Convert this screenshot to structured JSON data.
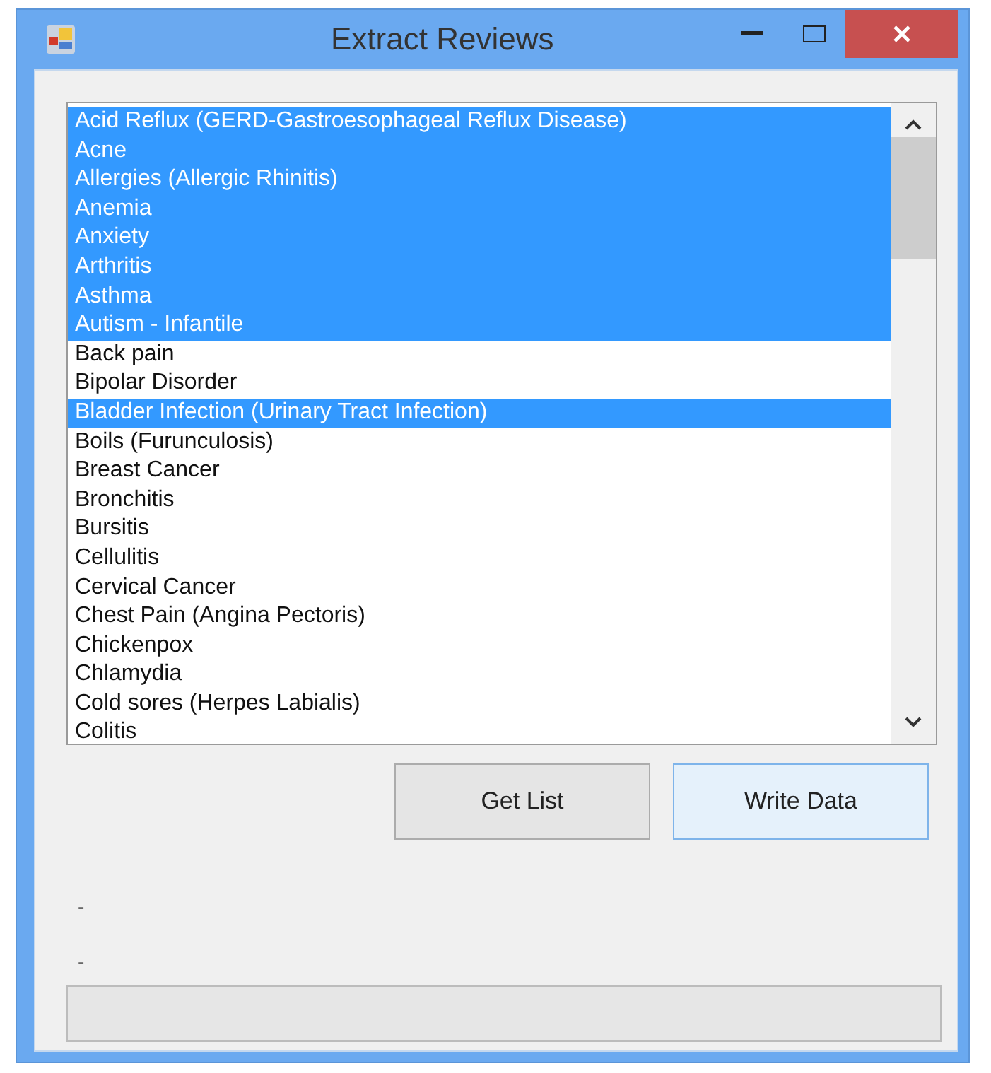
{
  "window": {
    "title": "Extract Reviews"
  },
  "list": {
    "items": [
      {
        "label": "Acid Reflux (GERD-Gastroesophageal Reflux Disease)",
        "selected": true
      },
      {
        "label": "Acne",
        "selected": true
      },
      {
        "label": "Allergies (Allergic Rhinitis)",
        "selected": true
      },
      {
        "label": "Anemia",
        "selected": true
      },
      {
        "label": "Anxiety",
        "selected": true
      },
      {
        "label": "Arthritis",
        "selected": true
      },
      {
        "label": "Asthma",
        "selected": true
      },
      {
        "label": "Autism - Infantile",
        "selected": true
      },
      {
        "label": "Back pain",
        "selected": false
      },
      {
        "label": "Bipolar Disorder",
        "selected": false
      },
      {
        "label": "Bladder Infection (Urinary Tract Infection)",
        "selected": true
      },
      {
        "label": "Boils (Furunculosis)",
        "selected": false
      },
      {
        "label": "Breast Cancer",
        "selected": false
      },
      {
        "label": "Bronchitis",
        "selected": false
      },
      {
        "label": "Bursitis",
        "selected": false
      },
      {
        "label": "Cellulitis",
        "selected": false
      },
      {
        "label": "Cervical Cancer",
        "selected": false
      },
      {
        "label": "Chest Pain (Angina Pectoris)",
        "selected": false
      },
      {
        "label": "Chickenpox",
        "selected": false
      },
      {
        "label": "Chlamydia",
        "selected": false
      },
      {
        "label": "Cold sores (Herpes Labialis)",
        "selected": false
      },
      {
        "label": "Colitis",
        "selected": false
      }
    ]
  },
  "buttons": [
    {
      "label": "Get List",
      "focused": false
    },
    {
      "label": "Write Data",
      "focused": true
    }
  ],
  "status_labels": [
    "-",
    "-"
  ]
}
